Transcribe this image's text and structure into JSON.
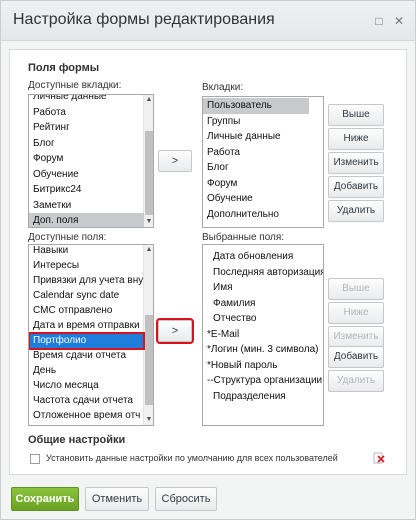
{
  "window": {
    "title": "Настройка формы редактирования",
    "minimize_icon": "□",
    "close_icon": "✕"
  },
  "form_fields": {
    "section_title": "Поля формы",
    "available_tabs_label": "Доступные вкладки:",
    "tabs_label": "Вкладки:",
    "available_fields_label": "Доступные поля:",
    "selected_fields_label": "Выбранные поля:",
    "available_tabs": [
      "Личные данные",
      "Работа",
      "Рейтинг",
      "Блог",
      "Форум",
      "Обучение",
      "Битрикс24",
      "Заметки",
      "Доп. поля"
    ],
    "available_tabs_selected_index": 8,
    "tabs": [
      "Пользователь",
      "Группы",
      "Личные данные",
      "Работа",
      "Блог",
      "Форум",
      "Обучение",
      "Дополнительно"
    ],
    "tabs_selected_index": 0,
    "available_fields": [
      "Навыки",
      "Интересы",
      "Привязки для учета вну",
      "Calendar sync date",
      "СМС отправлено",
      "Дата и время отправки",
      "Портфолио",
      "Время сдачи отчета",
      "День",
      "Число месяца",
      "Частота сдачи отчета",
      "Отложенное время отч"
    ],
    "available_fields_selected_index": 6,
    "selected_fields": [
      "Дата обновления",
      "Последняя авторизация",
      "Имя",
      "Фамилия",
      "Отчество",
      "*E-Mail",
      "*Логин (мин. 3 символа)",
      "*Новый пароль",
      "--Структура организации",
      "Подразделения"
    ],
    "tab_arrow": ">",
    "field_arrow": ">",
    "tab_buttons": {
      "up": "Выше",
      "down": "Ниже",
      "edit": "Изменить",
      "add": "Добавить",
      "delete": "Удалить"
    },
    "field_buttons": {
      "up": "Выше",
      "down": "Ниже",
      "edit": "Изменить",
      "add": "Добавить",
      "delete": "Удалить"
    }
  },
  "general_settings": {
    "section_title": "Общие настройки",
    "default_checkbox_label": "Установить данные настройки по умолчанию для всех пользователей",
    "default_checkbox_checked": false,
    "reset_icon": "delete-settings-icon"
  },
  "footer": {
    "save": "Сохранить",
    "cancel": "Отменить",
    "reset": "Сбросить"
  },
  "colors": {
    "selection_blue": "#1f7edb",
    "highlight_red": "#d8131c",
    "save_green": "#6aa123"
  }
}
